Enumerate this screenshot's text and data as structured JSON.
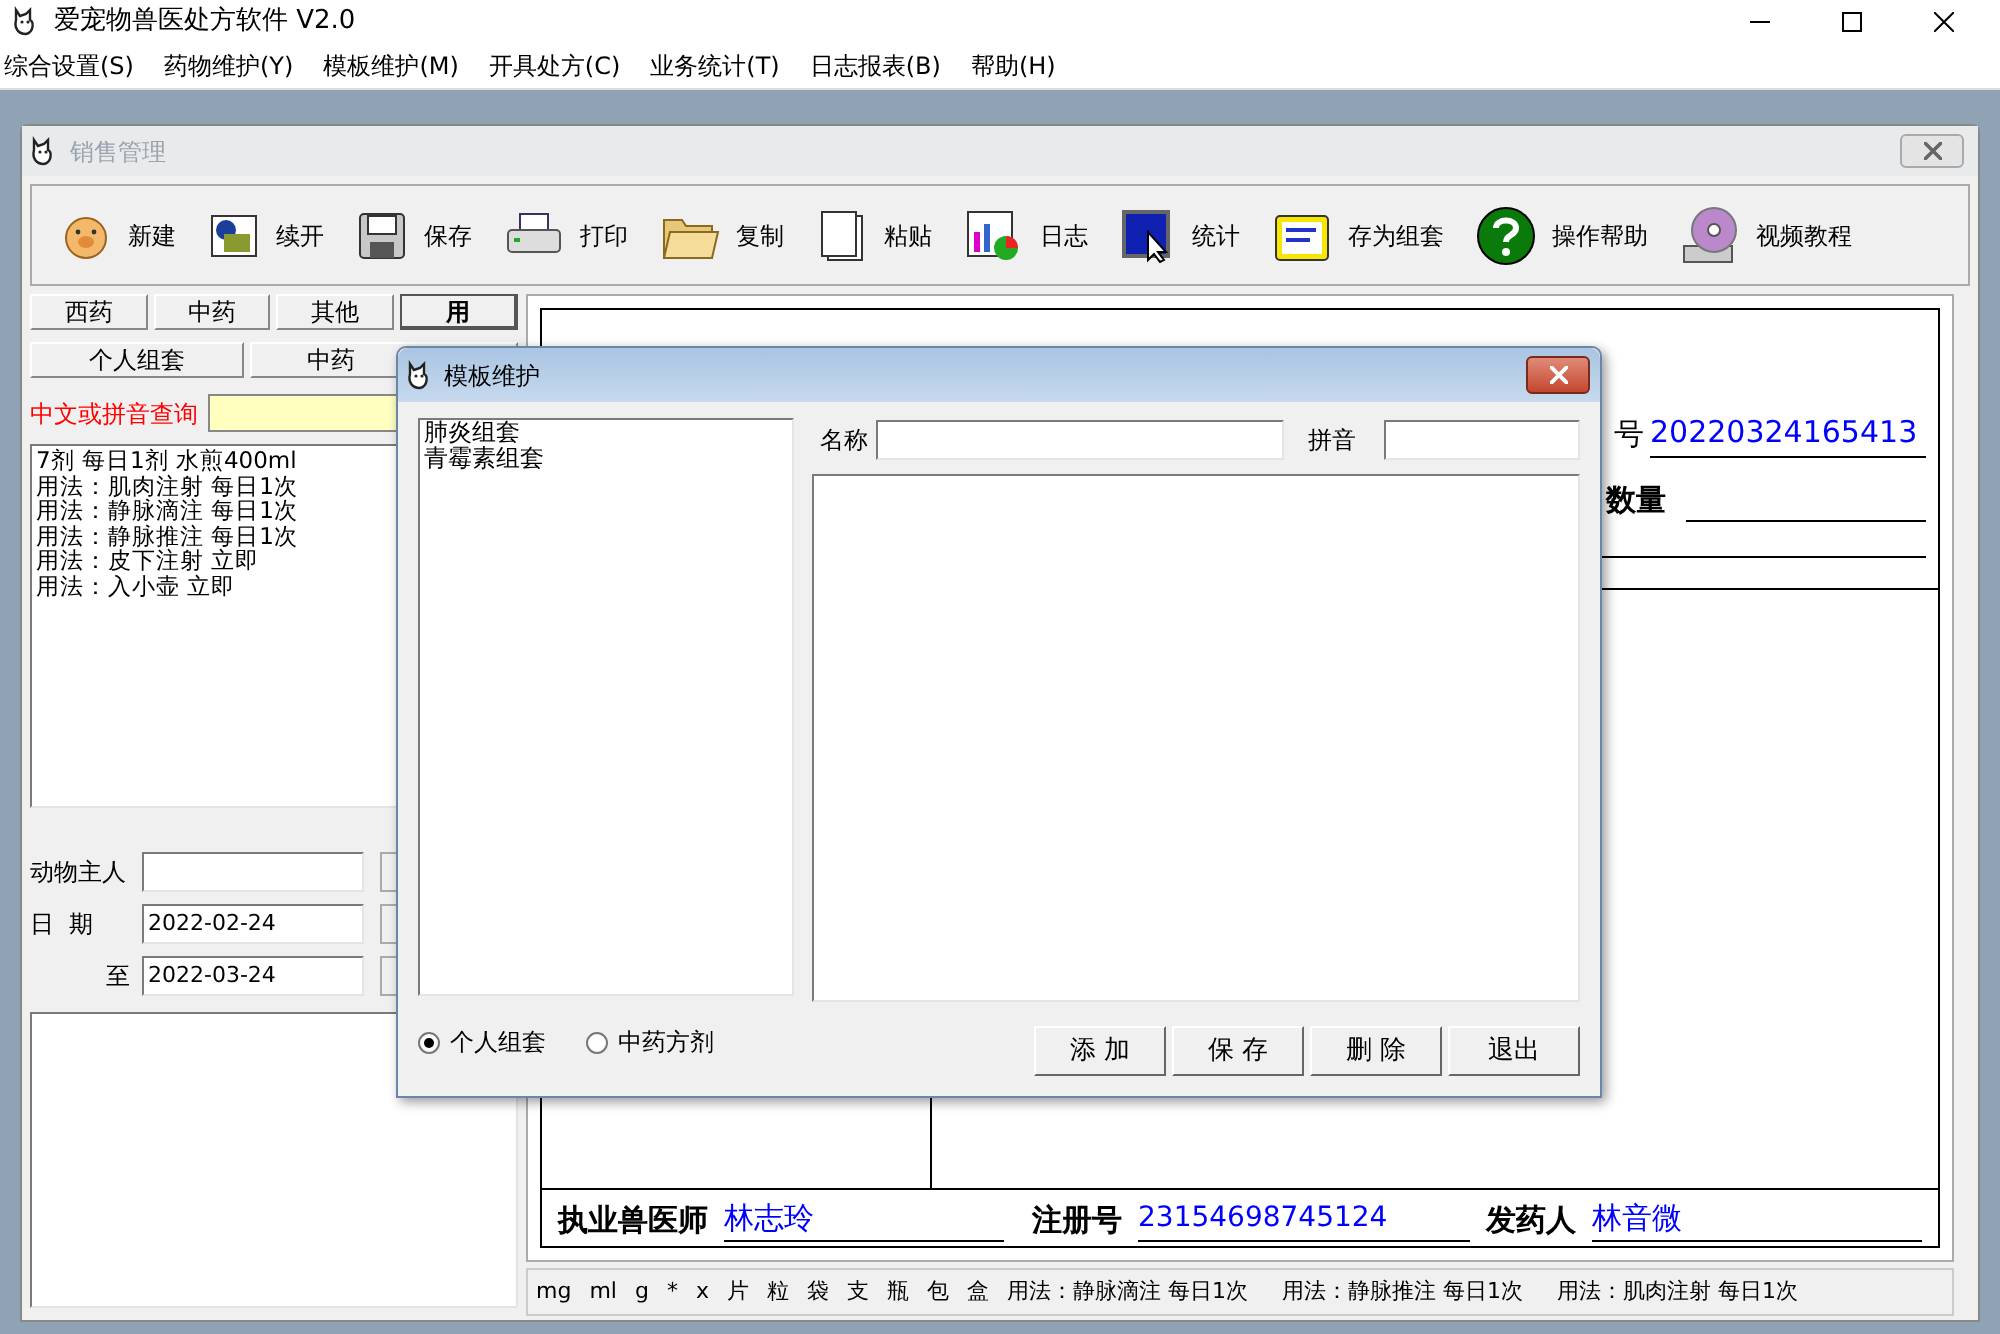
{
  "app": {
    "title": "爱宠物兽医处方软件 V2.0"
  },
  "menu": [
    "综合设置(S)",
    "药物维护(Y)",
    "模板维护(M)",
    "开具处方(C)",
    "业务统计(T)",
    "日志报表(B)",
    "帮助(H)"
  ],
  "child_window": {
    "title": "销售管理"
  },
  "toolbar": [
    {
      "label": "新建"
    },
    {
      "label": "续开"
    },
    {
      "label": "保存"
    },
    {
      "label": "打印"
    },
    {
      "label": "复制"
    },
    {
      "label": "粘贴"
    },
    {
      "label": "日志"
    },
    {
      "label": "统计"
    },
    {
      "label": "存为组套"
    },
    {
      "label": "操作帮助"
    },
    {
      "label": "视频教程"
    }
  ],
  "left_panel": {
    "category_tabs": [
      {
        "label": "西药",
        "selected": false
      },
      {
        "label": "中药",
        "selected": false
      },
      {
        "label": "其他",
        "selected": false
      },
      {
        "label": "用",
        "selected": true
      }
    ],
    "group_tabs": [
      "个人组套",
      "中药"
    ],
    "search": {
      "label": "中文或拼音查询"
    },
    "usage_list": [
      "7剂 每日1剂 水煎400ml",
      "用法：肌肉注射 每日1次",
      "用法：静脉滴注 每日1次",
      "用法：静脉推注 每日1次",
      "用法：皮下注射 立即",
      "用法：入小壶 立即"
    ],
    "owner": {
      "label": "动物主人"
    },
    "date_from": {
      "label": "日  期",
      "value": "2022-02-24"
    },
    "date_to": {
      "label": "至",
      "value": "2022-03-24"
    }
  },
  "prescription": {
    "number_label": "号",
    "number": "20220324165413",
    "quantity_label": "数量",
    "vet_label": "执业兽医师",
    "vet": "林志玲",
    "reg_label": "注册号",
    "reg": "23154698745124",
    "dispenser_label": "发药人",
    "dispenser": "林音微"
  },
  "status_bar": [
    "mg",
    "ml",
    "g",
    "*",
    "x",
    "片",
    "粒",
    "袋",
    "支",
    "瓶",
    "包",
    "盒",
    "用法：静脉滴注 每日1次",
    "用法：静脉推注 每日1次",
    "用法：肌肉注射 每日1次"
  ],
  "dialog": {
    "title": "模板维护",
    "templates": [
      "肺炎组套",
      "青霉素组套"
    ],
    "name_label": "名称",
    "pinyin_label": "拼音",
    "options": [
      {
        "label": "个人组套",
        "selected": true
      },
      {
        "label": "中药方剂",
        "selected": false
      }
    ],
    "buttons": [
      "添 加",
      "保 存",
      "删 除",
      "退出"
    ]
  }
}
